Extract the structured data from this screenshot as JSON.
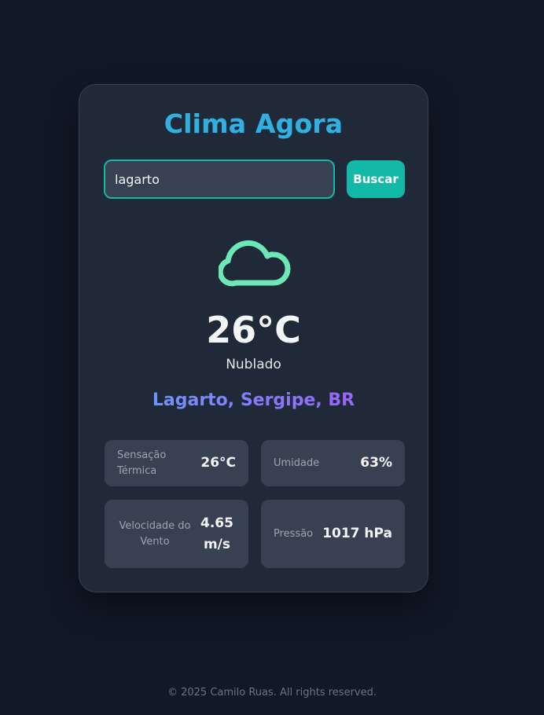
{
  "app": {
    "title": "Clima Agora"
  },
  "search": {
    "value": "lagarto",
    "placeholder": "",
    "button_label": "Buscar"
  },
  "weather": {
    "icon": "cloud-icon",
    "temperature": "26°C",
    "condition": "Nublado",
    "location": "Lagarto, Sergipe, BR"
  },
  "stats": {
    "feels_like": {
      "label": "Sensação Térmica",
      "value": "26°C"
    },
    "humidity": {
      "label": "Umidade",
      "value": "63%"
    },
    "wind_speed": {
      "label": "Velocidade do Vento",
      "value": "4.65 m/s"
    },
    "pressure": {
      "label": "Pressão",
      "value": "1017 hPa"
    }
  },
  "footer": {
    "text": "© 2025 Camilo Ruas. All rights reserved."
  },
  "colors": {
    "background": "#111827",
    "card": "#1f2937",
    "accent": "#14b8a6",
    "title": "#2fb0e0",
    "icon": "#6ee7b7",
    "location_gradient_start": "#60a5fa",
    "location_gradient_end": "#a855f7"
  }
}
